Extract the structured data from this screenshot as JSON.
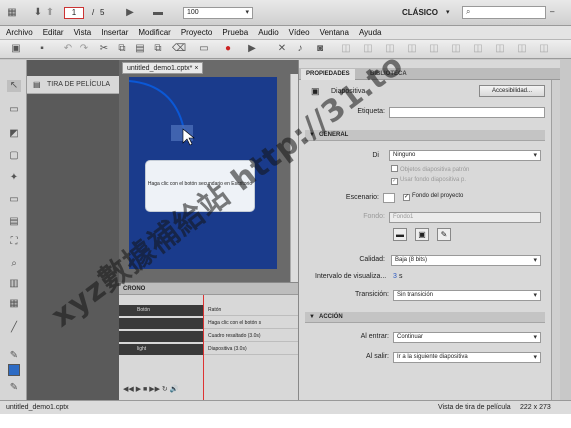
{
  "topbar": {
    "page_current": "1",
    "page_sep": "/",
    "page_total": "5",
    "zoom": "100",
    "workspace": "CLÁSICO",
    "search_placeholder": ""
  },
  "menu": [
    "Archivo",
    "Editar",
    "Vista",
    "Insertar",
    "Modificar",
    "Proyecto",
    "Prueba",
    "Audio",
    "Vídeo",
    "Ventana",
    "Ayuda"
  ],
  "filmstrip": {
    "title": "TIRA DE PELÍCULA"
  },
  "document": {
    "tab_title": "untitled_demo1.cptx*",
    "dialog_text": "Haga clic con el botón secundario en Escritorio"
  },
  "timeline": {
    "title": "CRONO",
    "rows": [
      {
        "left": "Botón",
        "right": "Ratón"
      },
      {
        "left": "",
        "right": "Haga clic con el botón s"
      },
      {
        "left": "",
        "right": "Cuadro resaltado (3.0s)"
      },
      {
        "left": "light",
        "right": "Diapositiva (3.0s)"
      }
    ]
  },
  "properties": {
    "tab_props": "PROPIEDADES",
    "tab_library": "BIBLIOTECA",
    "object_label": "Diapositiva",
    "accessibility_button": "Accesibilidad...",
    "label_tag": "Etiqueta:",
    "label_value": "",
    "general_section": "GENERAL",
    "design_label": "Di",
    "design_value": "Ninguno",
    "chk_master_objects": "Objetos diapositiva patrón",
    "chk_master_bg": "Usar fondo diapositiva p.",
    "stage_label": "Escenario:",
    "chk_project_bg": "Fondo del proyecto",
    "bg_label": "Fondo:",
    "bg_value": "Fondo1",
    "quality_label": "Calidad:",
    "quality_value": "Baja (8 bits)",
    "interval_label": "Intervalo de visualiza...",
    "interval_value": "3",
    "interval_unit": "s",
    "transition_label": "Transición:",
    "transition_value": "Sin transición",
    "action_section": "ACCIÓN",
    "on_enter_label": "Al entrar:",
    "on_enter_value": "Continuar",
    "on_exit_label": "Al salir:",
    "on_exit_value": "Ir a la siguiente diapositiva"
  },
  "status": {
    "file": "untitled_demo1.cptx",
    "view": "Vista de tira de película",
    "size": "222 x 273"
  },
  "watermark": "xyz數據補給站 http://31.to",
  "colors": {
    "slide_bg": "#1a3b8c",
    "selection": "#2d6bc4"
  }
}
